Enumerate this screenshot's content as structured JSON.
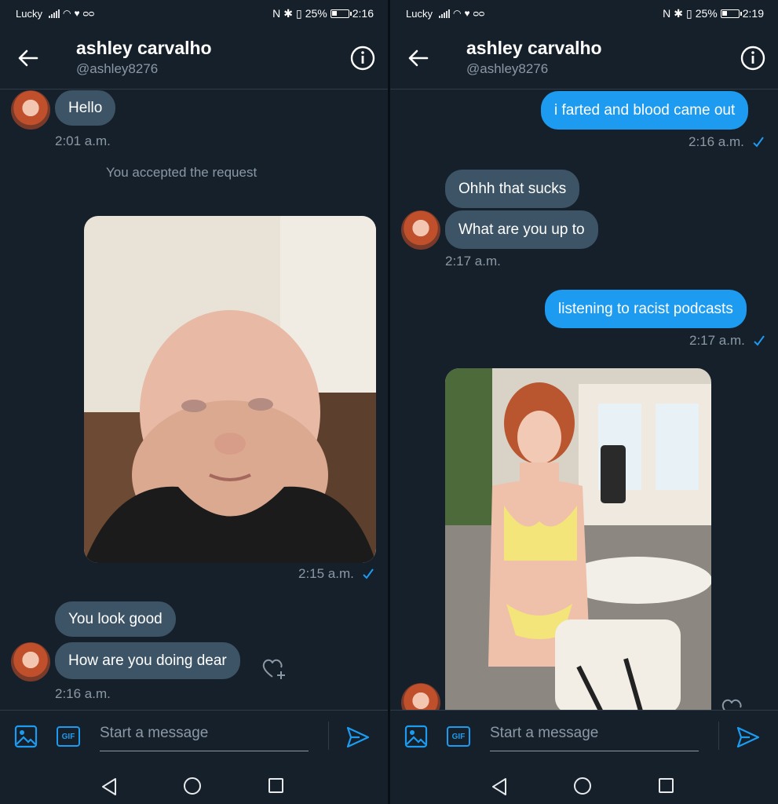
{
  "left": {
    "status": {
      "carrier": "Lucky",
      "battery": "25%",
      "time": "2:16"
    },
    "header": {
      "name": "ashley carvalho",
      "handle": "@ashley8276"
    },
    "messages": {
      "hello": "Hello",
      "hello_time": "2:01 a.m.",
      "accepted": "You accepted the request",
      "photo_time": "2:15 a.m.",
      "look_good": "You look good",
      "how_are_you": "How are you doing dear",
      "reply_time": "2:16 a.m."
    },
    "composer": {
      "placeholder": "Start a message",
      "gif_label": "GIF"
    }
  },
  "right": {
    "status": {
      "carrier": "Lucky",
      "battery": "25%",
      "time": "2:19"
    },
    "header": {
      "name": "ashley carvalho",
      "handle": "@ashley8276"
    },
    "messages": {
      "sent1": "i farted and blood came out",
      "sent1_time": "2:16 a.m.",
      "recv1": "Ohhh that sucks",
      "recv2": "What are you up to",
      "recv_time": "2:17 a.m.",
      "sent2": "listening to racist podcasts",
      "sent2_time": "2:17 a.m."
    },
    "composer": {
      "placeholder": "Start a message",
      "gif_label": "GIF"
    }
  },
  "colors": {
    "background": "#15202b",
    "accent": "#1d9bf0",
    "received_bubble": "#3d5466",
    "muted_text": "#8b98a5"
  },
  "icons": [
    "back-arrow-icon",
    "info-icon",
    "image-icon",
    "gif-icon",
    "send-icon",
    "heart-plus-icon",
    "checkmark-icon",
    "nav-back-icon",
    "nav-home-icon",
    "nav-recents-icon"
  ]
}
